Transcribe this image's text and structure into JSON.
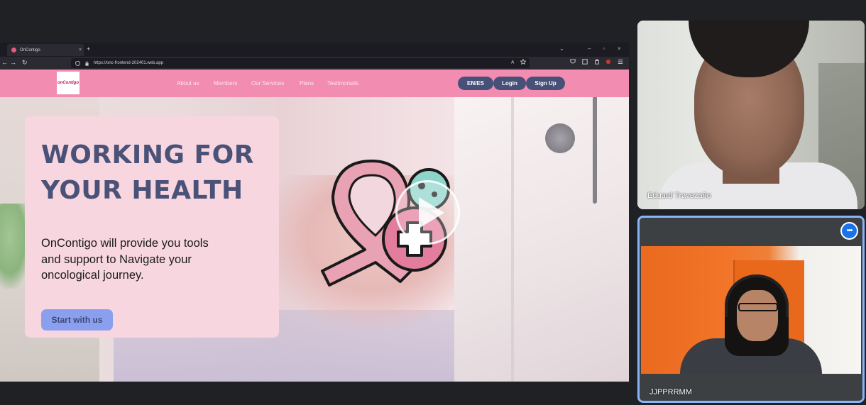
{
  "browser": {
    "tab_title": "OnContigo",
    "tab_close_icon": "×",
    "new_tab_icon": "+",
    "tab_list_icon": "⌄",
    "window_controls": [
      "–",
      "▫",
      "×"
    ],
    "url": "https://onc-frontend-202401.web.app",
    "nav_icons": [
      "←",
      "→",
      "↻"
    ],
    "toolbar_icons": [
      "translate-icon",
      "star-icon",
      "shield-icon",
      "pocket-icon",
      "extensions-icon",
      "addon-icon",
      "menu-icon"
    ]
  },
  "site": {
    "logo_text": "onContigo",
    "menu": [
      "About us",
      "Members",
      "Our Services",
      "Plans",
      "Testimonials"
    ],
    "lang_button": "EN/ES",
    "login_button": "Login",
    "signup_button": "Sign Up",
    "hero_title": "WORKING FOR YOUR HEALTH",
    "hero_text": "OnContigo will provide you tools and support to Navigate your oncological journey.",
    "cta_button": "Start with us",
    "colors": {
      "header": "#f28cb1",
      "card": "#f7d6e0",
      "title": "#4b5278",
      "cta": "#8aa0ef"
    }
  },
  "participants": [
    {
      "name": "Eduard Travezaño"
    },
    {
      "name": "JJPPRRMM"
    }
  ],
  "meeting": {
    "more_options_icon": "•••",
    "active_speaker_color": "#8ab4f8"
  }
}
